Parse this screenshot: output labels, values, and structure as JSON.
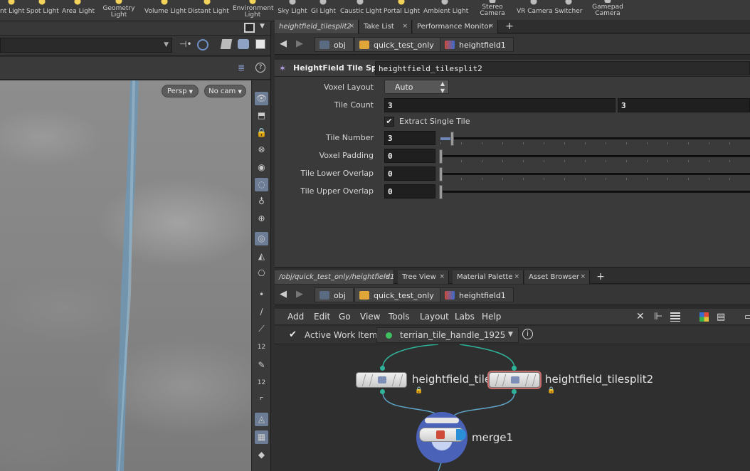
{
  "shelf": {
    "tools": [
      {
        "label": "nt Light",
        "icon": "light-bulb-icon"
      },
      {
        "label": "Spot Light",
        "icon": "spot-light-icon"
      },
      {
        "label": "Area Light",
        "icon": "area-light-icon"
      },
      {
        "label": "Geometry Light",
        "icon": "geometry-light-icon"
      },
      {
        "label": "Volume Light",
        "icon": "volume-light-icon"
      },
      {
        "label": "Distant Light",
        "icon": "distant-light-icon"
      },
      {
        "label": "Environment Light",
        "icon": "environment-light-icon"
      },
      {
        "label": "Sky Light",
        "icon": "sky-light-icon"
      },
      {
        "label": "GI Light",
        "icon": "gi-light-icon"
      },
      {
        "label": "Caustic Light",
        "icon": "caustic-light-icon"
      },
      {
        "label": "Portal Light",
        "icon": "portal-light-icon"
      },
      {
        "label": "Ambient Light",
        "icon": "ambient-light-icon"
      },
      {
        "label": "Stereo Camera",
        "icon": "stereo-camera-icon"
      },
      {
        "label": "VR Camera",
        "icon": "vr-camera-icon"
      },
      {
        "label": "Switcher",
        "icon": "switcher-icon"
      },
      {
        "label": "Gamepad Camera",
        "icon": "gamepad-camera-icon"
      }
    ]
  },
  "viewport": {
    "persp_label": "Persp",
    "cam_label": "No cam",
    "help_icon": "?",
    "tools": [
      "eye-icon",
      "select-icon",
      "lock-icon",
      "light-icon",
      "snapshot-icon",
      "lamp-icon",
      "bulb-icon",
      "bulb-add-icon",
      "render-icon",
      "shading-icon",
      "camera-icon",
      "dot-icon",
      "pen-icon",
      "measure-icon",
      "counter-icon",
      "brush-icon",
      "counter2-icon",
      "corner-icon",
      "grid-icon",
      "checker-icon",
      "drop-icon"
    ],
    "tool_texts": {
      "counter": "12",
      "counter2": "12"
    }
  },
  "top_pane": {
    "tabs": [
      {
        "label": "heightfield_tilesplit2",
        "current": true
      },
      {
        "label": "Take List"
      },
      {
        "label": "Performance Monitor"
      }
    ],
    "path": [
      "obj",
      "quick_test_only",
      "heightfield1"
    ]
  },
  "params": {
    "node_type": "HeightField Tile Split",
    "node_name": "heightfield_tilesplit2",
    "voxel_layout": {
      "label": "Voxel Layout",
      "value": "Auto"
    },
    "tile_count": {
      "label": "Tile Count",
      "x": "3",
      "y": "3"
    },
    "extract_single_tile": {
      "label": "Extract Single Tile",
      "checked": true
    },
    "tile_number": {
      "label": "Tile Number",
      "value": "3"
    },
    "voxel_padding": {
      "label": "Voxel Padding",
      "value": "0"
    },
    "tile_lower_overlap": {
      "label": "Tile Lower Overlap",
      "value": "0"
    },
    "tile_upper_overlap": {
      "label": "Tile Upper Overlap",
      "value": "0"
    }
  },
  "bottom_pane": {
    "tabs": [
      {
        "label": "/obj/quick_test_only/heightfield1",
        "current": true
      },
      {
        "label": "Tree View"
      },
      {
        "label": "Material Palette"
      },
      {
        "label": "Asset Browser"
      }
    ],
    "path": [
      "obj",
      "quick_test_only",
      "heightfield1"
    ],
    "menu": [
      "Add",
      "Edit",
      "Go",
      "View",
      "Tools",
      "Layout",
      "Labs",
      "Help"
    ],
    "active_work_item_label": "Active Work Item:",
    "active_work_item_value": "terrian_tile_handle_1925"
  },
  "network": {
    "nodes": [
      {
        "name": "heightfield_tiles"
      },
      {
        "name": "heightfield_tilesplit2",
        "selected": true
      },
      {
        "name": "merge1"
      }
    ]
  },
  "colors": {
    "accent": "#6c7d95",
    "port": "#2fb39a",
    "selected_outline": "#c76d6d",
    "status_green": "#3fbf5f"
  }
}
